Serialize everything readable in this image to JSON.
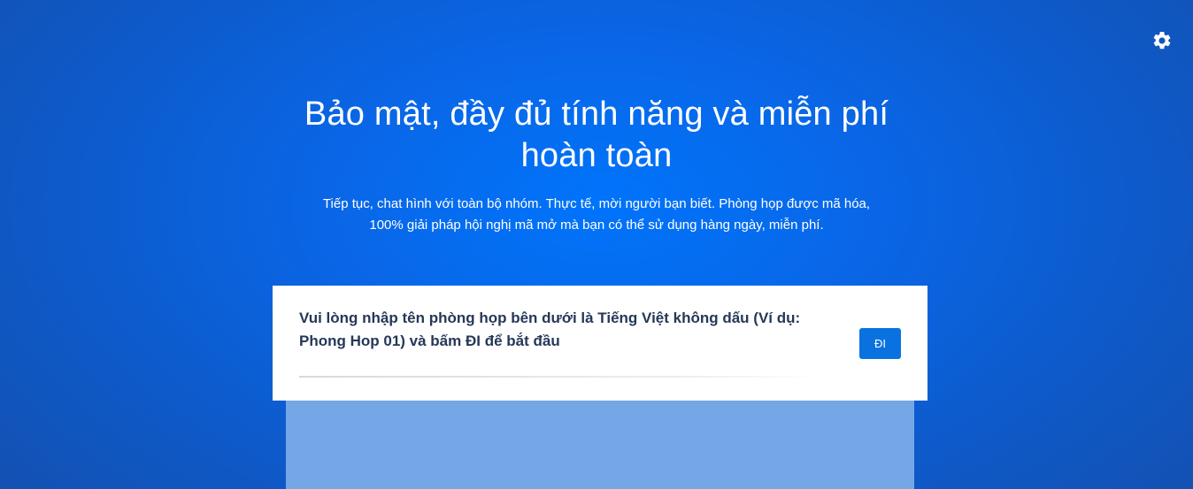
{
  "header": {
    "settings_icon": "gear-icon"
  },
  "hero": {
    "title": "Bảo mật, đầy đủ tính năng và miễn phí hoàn toàn",
    "subtitle": "Tiếp tục, chat hình với toàn bộ nhóm. Thực tế, mời người bạn biết. Phòng họp được mã hóa, 100% giải pháp hội nghị mã mở mà bạn có thể sử dụng hàng ngày, miễn phí."
  },
  "join_card": {
    "prompt": "Vui lòng nhập tên phòng họp bên dưới là Tiếng Việt không dấu (Ví dụ: Phong Hop 01) và bấm ĐI để bắt đầu",
    "go_label": "ĐI"
  },
  "colors": {
    "background": "#0a66e6",
    "button": "#0a72e0",
    "card_text": "#253858",
    "preview_panel": "#75a6e6"
  }
}
